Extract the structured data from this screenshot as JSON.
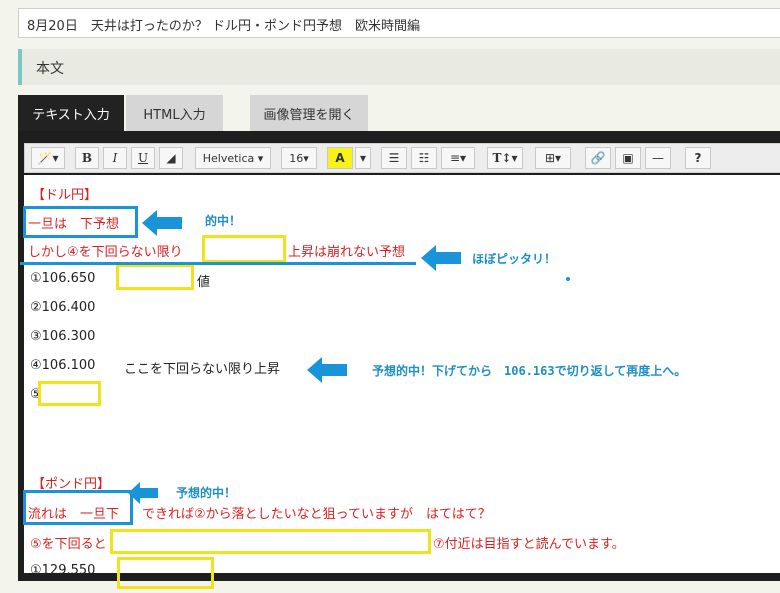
{
  "title": "8月20日　天井は打ったのか？ ドル円・ポンド円予想　欧米時間編",
  "section_label": "本文",
  "tabs": {
    "text": "テキスト入力",
    "html": "HTML入力",
    "image": "画像管理を開く"
  },
  "toolbar": {
    "magic": "🪄▾",
    "bold": "B",
    "italic": "I",
    "underline": "U",
    "eraser": "◢",
    "font": "Helvetica ▾",
    "size": "16▾",
    "color": "A",
    "color_drop": "▾",
    "ul": "☰",
    "ol": "☷",
    "align": "≡▾",
    "style": "T↕▾",
    "table": "⊞▾",
    "link": "🔗",
    "picture": "▣",
    "hr": "—",
    "help": "?"
  },
  "content": {
    "l1": "【ドル円】",
    "l2": "一旦は　下予想",
    "l3a": "しかし④を下回らない限り",
    "l3b": "上昇は崩れない予想",
    "l4a": "①106.650",
    "l4b": "値",
    "l5": "②106.400",
    "l6": "③106.300",
    "l7a": "④106.100",
    "l7b": "ここを下回らない限り上昇",
    "l8": "⑤",
    "l9": "【ポンド円】",
    "l10a": "流れは　一旦下",
    "l10b": "できれば②から落としたいなと狙っていますが　はてはて？",
    "l11a": "⑤を下回ると",
    "l11b": "⑦付近は目指すと読んでいます。",
    "l12": "①129.550"
  },
  "annotations": {
    "a1": "的中！",
    "a2": "ほぼピッタリ！",
    "a3": "予想的中！下げてから　106.163で切り返して再度上へ。",
    "a4": "予想的中！"
  }
}
